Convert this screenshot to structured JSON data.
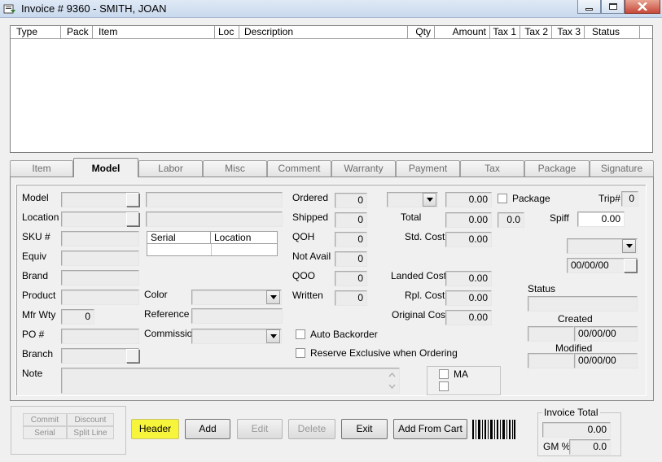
{
  "window": {
    "title": "Invoice # 9360  -  SMITH, JOAN",
    "min_icon": "minimize-icon",
    "max_icon": "maximize-icon",
    "close_icon": "close-icon"
  },
  "grid": {
    "columns": [
      "Type",
      "Pack",
      "Item",
      "Loc",
      "Description",
      "Qty",
      "Amount",
      "Tax 1",
      "Tax 2",
      "Tax 3",
      "Status"
    ],
    "rows": []
  },
  "tabs": [
    {
      "label": "Item",
      "active": false
    },
    {
      "label": "Model",
      "active": true
    },
    {
      "label": "Labor",
      "active": false
    },
    {
      "label": "Misc",
      "active": false
    },
    {
      "label": "Comment",
      "active": false
    },
    {
      "label": "Warranty",
      "active": false
    },
    {
      "label": "Payment",
      "active": false
    },
    {
      "label": "Tax",
      "active": false
    },
    {
      "label": "Package",
      "active": false
    },
    {
      "label": "Signature",
      "active": false
    }
  ],
  "model": {
    "labels": {
      "model": "Model",
      "location": "Location",
      "sku": "SKU #",
      "equiv": "Equiv",
      "brand": "Brand",
      "product": "Product",
      "mfr_wty": "Mfr Wty",
      "po": "PO #",
      "branch": "Branch",
      "note": "Note",
      "color": "Color",
      "reference": "Reference",
      "commission": "Commission"
    },
    "mfr_wty_value": "0",
    "serial_table": {
      "columns": [
        "Serial",
        "Location"
      ]
    },
    "qty_labels": {
      "ordered": "Ordered",
      "shipped": "Shipped",
      "qoh": "QOH",
      "not_avail": "Not Avail",
      "qoo": "QOO",
      "written": "Written"
    },
    "qty_values": {
      "ordered": "0",
      "shipped": "0",
      "qoh": "0",
      "not_avail": "0",
      "qoo": "0",
      "written": "0"
    },
    "auto_backorder": "Auto Backorder",
    "reserve_exclusive": "Reserve Exclusive when Ordering",
    "pricing": {
      "price": "0.00",
      "total_label": "Total",
      "total": "0.00",
      "total_pct": "0.0",
      "std_cost_label": "Std. Cost",
      "std_cost": "0.00",
      "landed_cost_label": "Landed Cost",
      "landed_cost": "0.00",
      "rpl_cost_label": "Rpl. Cost",
      "rpl_cost": "0.00",
      "original_cost_label": "Original Cost",
      "original_cost": "0.00"
    },
    "package_label": "Package",
    "trip_label": "Trip#",
    "trip_value": "0",
    "spiff_label": "Spiff",
    "spiff_value": "0.00",
    "date_value": "00/00/00",
    "status_label": "Status",
    "created_label": "Created",
    "created_date": "00/00/00",
    "modified_label": "Modified",
    "modified_date": "00/00/00",
    "ma_label": "MA"
  },
  "footer": {
    "small_buttons": [
      "Commit",
      "Discount",
      "Serial",
      "Split Line"
    ],
    "buttons": {
      "header": "Header",
      "add": "Add",
      "edit": "Edit",
      "delete": "Delete",
      "exit": "Exit",
      "add_from_cart": "Add From Cart"
    },
    "barcode_icon": "barcode-icon",
    "invoice_total_label": "Invoice Total",
    "invoice_total": "0.00",
    "gm_label": "GM %",
    "gm_value": "0.0"
  },
  "colors": {
    "highlight": "#f7f43c",
    "window_bg": "#f0f0f0"
  }
}
